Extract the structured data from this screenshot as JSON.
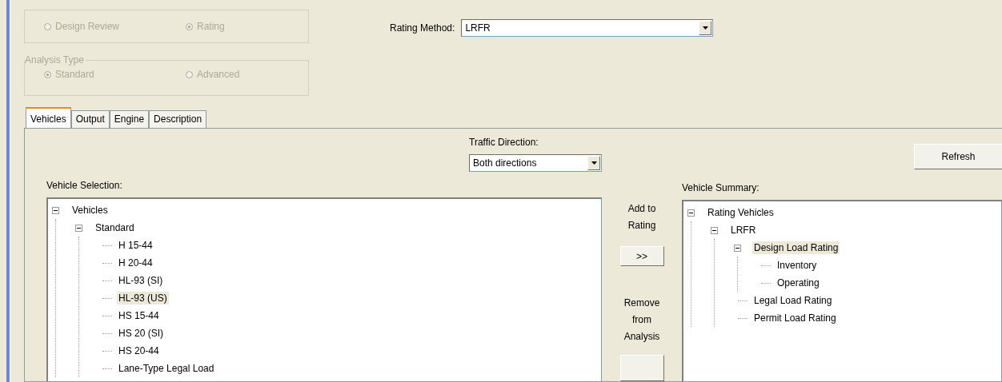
{
  "mode_group": {
    "disabled": true,
    "options": [
      {
        "label": "Design Review",
        "selected": false
      },
      {
        "label": "Rating",
        "selected": true
      }
    ]
  },
  "analysis_type": {
    "title": "Analysis Type",
    "disabled": true,
    "options": [
      {
        "label": "Standard",
        "selected": true
      },
      {
        "label": "Advanced",
        "selected": false
      }
    ]
  },
  "rating_method": {
    "label": "Rating Method:",
    "value": "LRFR"
  },
  "tabs": [
    {
      "label": "Vehicles",
      "selected": true
    },
    {
      "label": "Output",
      "selected": false
    },
    {
      "label": "Engine",
      "selected": false
    },
    {
      "label": "Description",
      "selected": false
    }
  ],
  "traffic_direction": {
    "label": "Traffic Direction:",
    "value": "Both directions"
  },
  "refresh_button": "Refresh",
  "vehicle_selection": {
    "label": "Vehicle Selection:",
    "tree": [
      {
        "label": "Vehicles",
        "expanded": true,
        "selected": false,
        "children": [
          {
            "label": "Standard",
            "expanded": true,
            "selected": false,
            "children": [
              {
                "label": "H 15-44",
                "selected": false
              },
              {
                "label": "H 20-44",
                "selected": false
              },
              {
                "label": "HL-93 (SI)",
                "selected": false
              },
              {
                "label": "HL-93 (US)",
                "selected": true
              },
              {
                "label": "HS 15-44",
                "selected": false
              },
              {
                "label": "HS 20 (SI)",
                "selected": false
              },
              {
                "label": "HS 20-44",
                "selected": false
              },
              {
                "label": "Lane-Type Legal Load",
                "selected": false
              }
            ]
          }
        ]
      }
    ]
  },
  "add_to_rating": {
    "label": "Add to Rating",
    "button": ">>"
  },
  "remove_from_analysis": {
    "label": "Remove from Analysis"
  },
  "vehicle_summary": {
    "label": "Vehicle Summary:",
    "tree": [
      {
        "label": "Rating Vehicles",
        "expanded": true,
        "selected": false,
        "children": [
          {
            "label": "LRFR",
            "expanded": true,
            "selected": false,
            "children": [
              {
                "label": "Design Load Rating",
                "expanded": true,
                "selected": true,
                "children": [
                  {
                    "label": "Inventory",
                    "selected": false
                  },
                  {
                    "label": "Operating",
                    "selected": false
                  }
                ]
              },
              {
                "label": "Legal Load Rating",
                "selected": false
              },
              {
                "label": "Permit Load Rating",
                "selected": false
              }
            ]
          }
        ]
      }
    ]
  }
}
